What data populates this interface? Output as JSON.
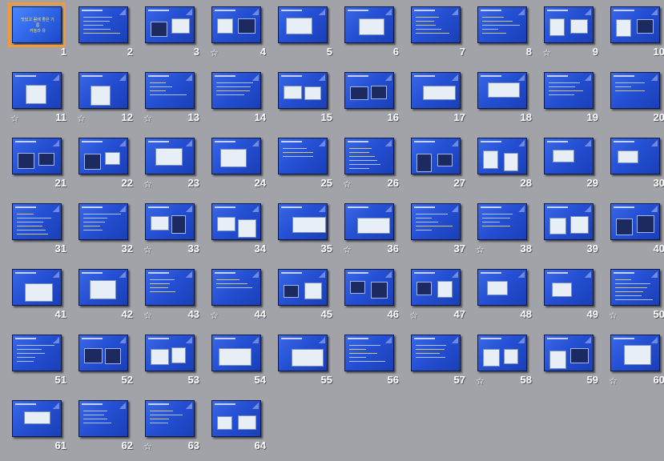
{
  "slide_sorter": {
    "selected_slide": 1,
    "selected_title_lines": [
      "맛있고 몸에 좋은 기름",
      "카놀라 유"
    ],
    "slides": [
      {
        "number": "1",
        "star": false
      },
      {
        "number": "2",
        "star": false
      },
      {
        "number": "3",
        "star": false
      },
      {
        "number": "4",
        "star": true
      },
      {
        "number": "5",
        "star": false
      },
      {
        "number": "6",
        "star": false
      },
      {
        "number": "7",
        "star": false
      },
      {
        "number": "8",
        "star": false
      },
      {
        "number": "9",
        "star": true
      },
      {
        "number": "10",
        "star": false
      },
      {
        "number": "11",
        "star": true
      },
      {
        "number": "12",
        "star": true
      },
      {
        "number": "13",
        "star": true
      },
      {
        "number": "14",
        "star": false
      },
      {
        "number": "15",
        "star": false
      },
      {
        "number": "16",
        "star": false
      },
      {
        "number": "17",
        "star": false
      },
      {
        "number": "18",
        "star": false
      },
      {
        "number": "19",
        "star": false
      },
      {
        "number": "20",
        "star": false
      },
      {
        "number": "21",
        "star": false
      },
      {
        "number": "22",
        "star": false
      },
      {
        "number": "23",
        "star": true
      },
      {
        "number": "24",
        "star": false
      },
      {
        "number": "25",
        "star": false
      },
      {
        "number": "26",
        "star": true
      },
      {
        "number": "27",
        "star": false
      },
      {
        "number": "28",
        "star": false
      },
      {
        "number": "29",
        "star": false
      },
      {
        "number": "30",
        "star": false
      },
      {
        "number": "31",
        "star": false
      },
      {
        "number": "32",
        "star": false
      },
      {
        "number": "33",
        "star": true
      },
      {
        "number": "34",
        "star": false
      },
      {
        "number": "35",
        "star": false
      },
      {
        "number": "36",
        "star": true
      },
      {
        "number": "37",
        "star": false
      },
      {
        "number": "38",
        "star": true
      },
      {
        "number": "39",
        "star": false
      },
      {
        "number": "40",
        "star": false
      },
      {
        "number": "41",
        "star": false
      },
      {
        "number": "42",
        "star": false
      },
      {
        "number": "43",
        "star": true
      },
      {
        "number": "44",
        "star": true
      },
      {
        "number": "45",
        "star": false
      },
      {
        "number": "46",
        "star": false
      },
      {
        "number": "47",
        "star": true
      },
      {
        "number": "48",
        "star": false
      },
      {
        "number": "49",
        "star": false
      },
      {
        "number": "50",
        "star": true
      },
      {
        "number": "51",
        "star": false
      },
      {
        "number": "52",
        "star": false
      },
      {
        "number": "53",
        "star": false
      },
      {
        "number": "54",
        "star": false
      },
      {
        "number": "55",
        "star": false
      },
      {
        "number": "56",
        "star": false
      },
      {
        "number": "57",
        "star": false
      },
      {
        "number": "58",
        "star": true
      },
      {
        "number": "59",
        "star": false
      },
      {
        "number": "60",
        "star": true
      },
      {
        "number": "61",
        "star": false
      },
      {
        "number": "62",
        "star": false
      },
      {
        "number": "63",
        "star": true
      },
      {
        "number": "64",
        "star": false
      }
    ],
    "star_glyph": "☆",
    "colors": {
      "background": "#a2a3a9",
      "slide_blue": "#2550d4",
      "selection": "#f29a3a",
      "accent_text": "#ffe35a"
    }
  }
}
